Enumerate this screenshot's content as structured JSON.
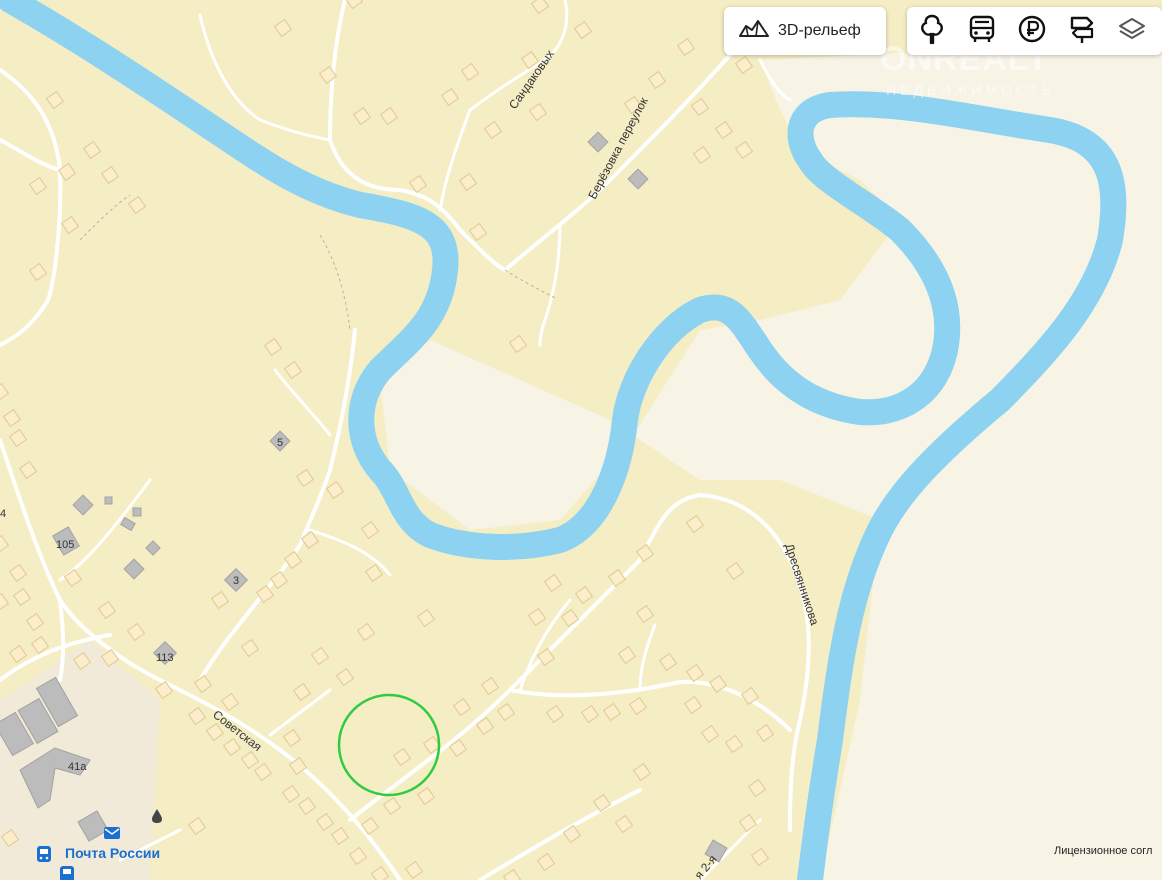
{
  "controls": {
    "relief_label": "3D-рельеф",
    "relief_icon": "relief-3d-icon",
    "toolbar_icons": [
      "tree-icon",
      "bus-icon",
      "ruble-icon",
      "signpost-icon",
      "layers-icon"
    ]
  },
  "watermark": {
    "brand": "ONREALT",
    "sub": "НЕДВИЖИМОСТЬ"
  },
  "streets": {
    "sandakovykh": "Сандаковых",
    "berezovka": "Берёзовка переулок",
    "dresvyannikova": "Дресвянникова",
    "sovetskaya": "Советская",
    "second": "я 2-я"
  },
  "house_numbers": {
    "n5": "5",
    "n105": "105",
    "n3": "3",
    "n113": "113",
    "n41a": "41а",
    "n4": "4"
  },
  "poi": {
    "post_office": "Почта России",
    "post_icon": "mail-icon",
    "bus_stop_icon": "bus-stop-icon",
    "fuel_icon": "fuel-drop-icon"
  },
  "license_text": "Лицензионное согл",
  "colors": {
    "land": "#f5edc4",
    "meadow": "#f7f4e6",
    "river": "#8dd2f0",
    "road": "#ffffff",
    "building": "#fdeecb",
    "building_stroke": "#e3cf9a",
    "gray_building": "#b8b8b8",
    "marker": "#2ecc40"
  }
}
